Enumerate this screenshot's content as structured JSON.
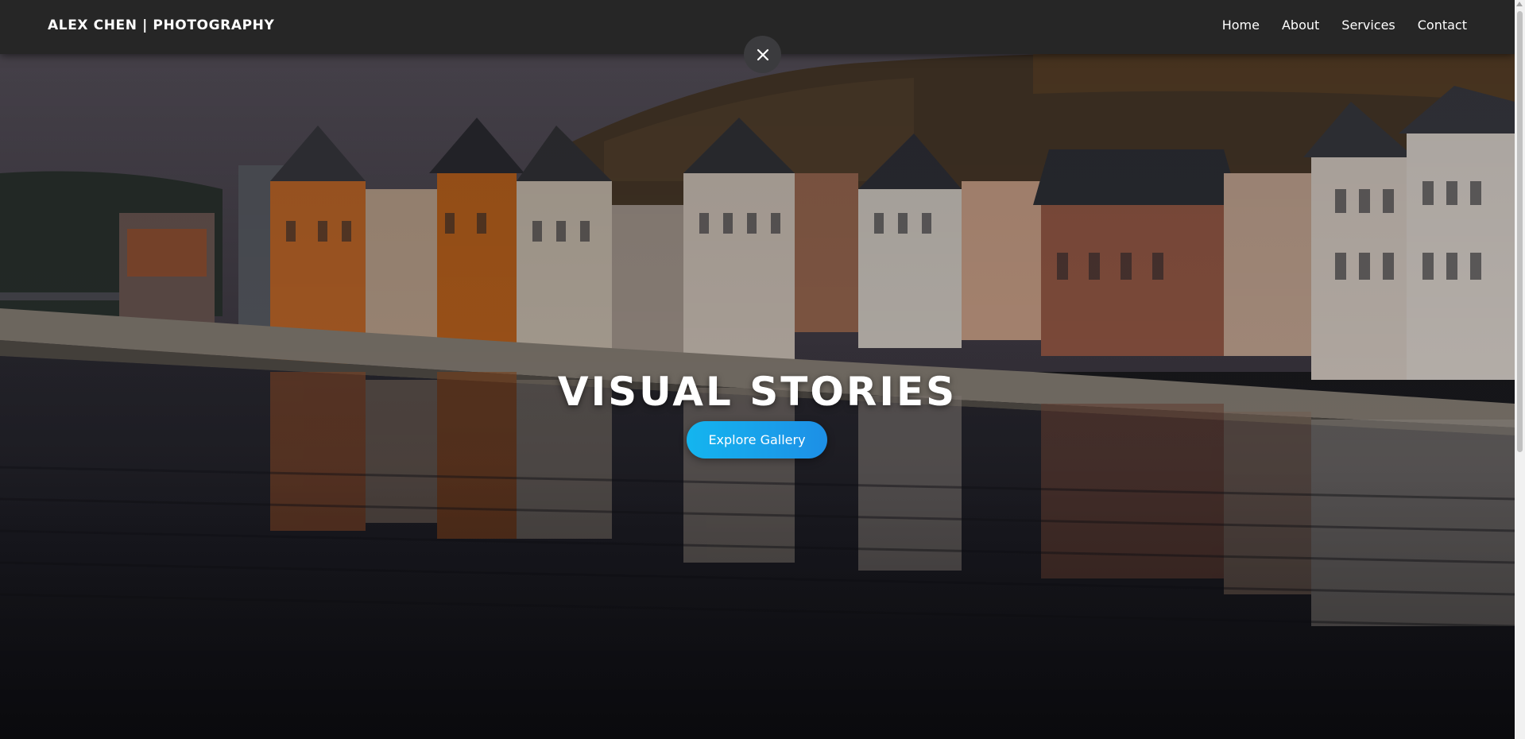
{
  "header": {
    "brand": "ALEX CHEN | PHOTOGRAPHY",
    "nav": [
      {
        "label": "Home"
      },
      {
        "label": "About"
      },
      {
        "label": "Services"
      },
      {
        "label": "Contact"
      }
    ]
  },
  "overlay": {
    "close_icon": "close-icon"
  },
  "hero": {
    "title": "VISUAL STORIES",
    "cta_label": "Explore Gallery",
    "background": "riverside-town-photo"
  },
  "colors": {
    "navbar": "#262626",
    "accent_start": "#14b5ef",
    "accent_end": "#1d8fe6",
    "text": "#ffffff"
  }
}
